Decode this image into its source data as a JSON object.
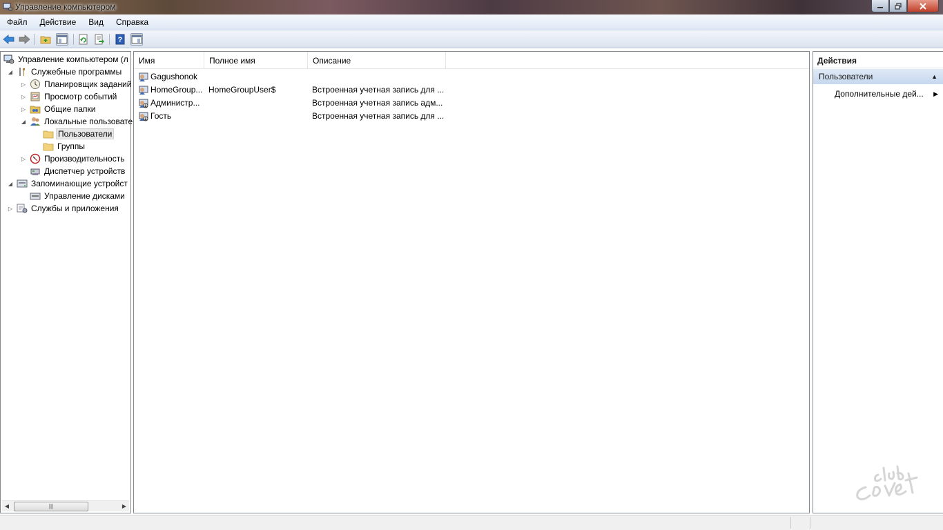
{
  "window": {
    "title": "Управление компьютером"
  },
  "menu": [
    "Файл",
    "Действие",
    "Вид",
    "Справка"
  ],
  "tree": [
    {
      "label": "Управление компьютером (л",
      "level": 0,
      "expander": "",
      "icon": "computer-management-icon"
    },
    {
      "label": "Служебные программы",
      "level": 1,
      "expander": "expanded",
      "icon": "tools-icon"
    },
    {
      "label": "Планировщик заданий",
      "level": 2,
      "expander": "collapsed",
      "icon": "clock-icon"
    },
    {
      "label": "Просмотр событий",
      "level": 2,
      "expander": "collapsed",
      "icon": "event-viewer-icon"
    },
    {
      "label": "Общие папки",
      "level": 2,
      "expander": "collapsed",
      "icon": "shared-folder-icon"
    },
    {
      "label": "Локальные пользовате",
      "level": 2,
      "expander": "expanded",
      "icon": "users-icon"
    },
    {
      "label": "Пользователи",
      "level": 3,
      "expander": "",
      "icon": "folder-icon",
      "selected": true
    },
    {
      "label": "Группы",
      "level": 3,
      "expander": "",
      "icon": "folder-icon"
    },
    {
      "label": "Производительность",
      "level": 2,
      "expander": "collapsed",
      "icon": "performance-icon"
    },
    {
      "label": "Диспетчер устройств",
      "level": 2,
      "expander": "",
      "icon": "device-manager-icon"
    },
    {
      "label": "Запоминающие устройст",
      "level": 1,
      "expander": "expanded",
      "icon": "storage-icon"
    },
    {
      "label": "Управление дисками",
      "level": 2,
      "expander": "",
      "icon": "disk-management-icon"
    },
    {
      "label": "Службы и приложения",
      "level": 1,
      "expander": "collapsed",
      "icon": "services-icon"
    }
  ],
  "list": {
    "columns": [
      "Имя",
      "Полное имя",
      "Описание"
    ],
    "rows": [
      {
        "name": "Gagushonok",
        "full_name": "",
        "description": "",
        "icon": "user-icon"
      },
      {
        "name": "HomeGroup...",
        "full_name": "HomeGroupUser$",
        "description": "Встроенная учетная запись для ...",
        "icon": "user-icon"
      },
      {
        "name": "Администр...",
        "full_name": "",
        "description": "Встроенная учетная запись адм...",
        "icon": "disabled-user-icon"
      },
      {
        "name": "Гость",
        "full_name": "",
        "description": "Встроенная учетная запись для ...",
        "icon": "disabled-user-icon"
      }
    ]
  },
  "actions": {
    "header": "Действия",
    "section": "Пользователи",
    "items": [
      "Дополнительные дей..."
    ]
  },
  "colors": {
    "accent": "#c6d8ee",
    "selection": "#e7e7e7"
  }
}
